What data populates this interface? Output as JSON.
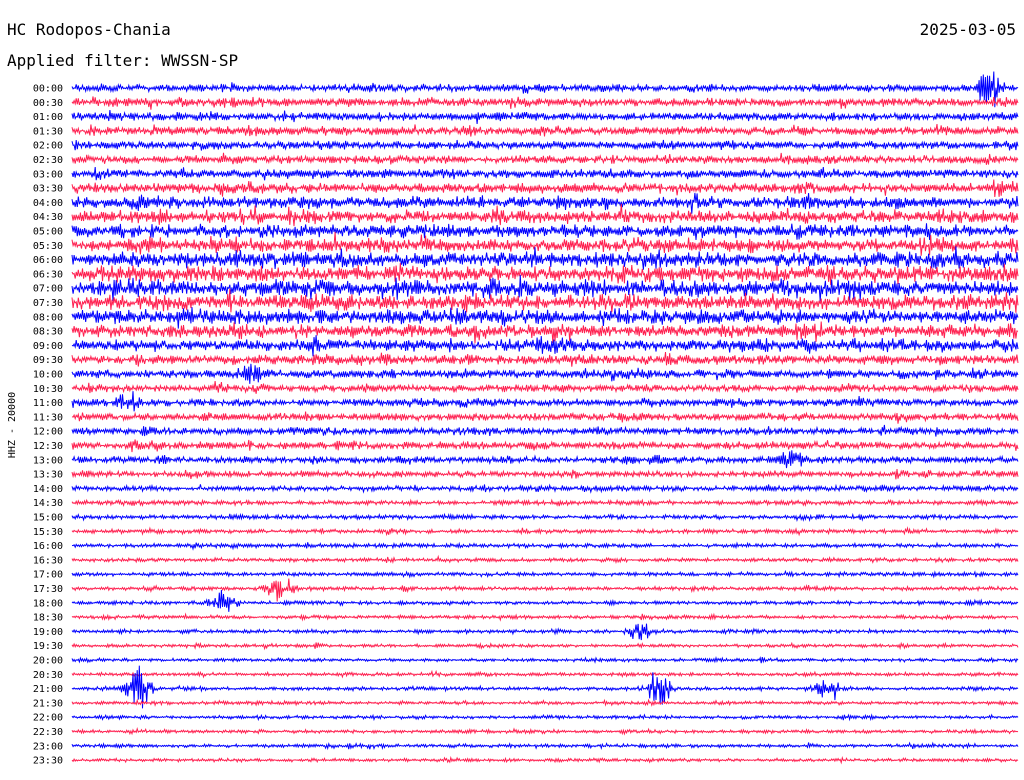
{
  "header": {
    "station": "HC Rodopos-Chania",
    "date": "2025-03-05",
    "filter": "Applied filter: WWSSN-SP"
  },
  "colors": {
    "trace_a": "#0000ff",
    "trace_b": "#ff1f4f",
    "background": "#ffffff",
    "text": "#000000"
  },
  "chart_data": {
    "type": "line",
    "title": "HC Rodopos-Chania",
    "ylabel": "HHZ - 20000",
    "xlabel": "",
    "grid": false,
    "legend": "none",
    "row_labels": [
      "00:00",
      "00:30",
      "01:00",
      "01:30",
      "02:00",
      "02:30",
      "03:00",
      "03:30",
      "04:00",
      "04:30",
      "05:00",
      "05:30",
      "06:00",
      "06:30",
      "07:00",
      "07:30",
      "08:00",
      "08:30",
      "09:00",
      "09:30",
      "10:00",
      "10:30",
      "11:00",
      "11:30",
      "12:00",
      "12:30",
      "13:00",
      "13:30",
      "14:00",
      "14:30",
      "15:00",
      "15:30",
      "16:00",
      "16:30",
      "17:00",
      "17:30",
      "18:00",
      "18:30",
      "19:00",
      "19:30",
      "20:00",
      "20:30",
      "21:00",
      "21:30",
      "22:00",
      "22:30",
      "23:00",
      "23:30"
    ],
    "row_color_cycle": [
      "blue",
      "red"
    ],
    "row_amplitude": [
      0.55,
      0.6,
      0.6,
      0.65,
      0.6,
      0.6,
      0.65,
      0.75,
      0.9,
      1.0,
      1.0,
      1.05,
      1.15,
      1.2,
      1.2,
      1.15,
      1.1,
      1.0,
      0.9,
      0.75,
      0.6,
      0.55,
      0.55,
      0.55,
      0.55,
      0.55,
      0.5,
      0.45,
      0.4,
      0.35,
      0.32,
      0.3,
      0.3,
      0.28,
      0.28,
      0.28,
      0.28,
      0.26,
      0.26,
      0.25,
      0.25,
      0.25,
      0.25,
      0.25,
      0.25,
      0.25,
      0.25,
      0.25
    ],
    "events": [
      {
        "row": "00:00",
        "position": 0.97,
        "strength": 2.6
      },
      {
        "row": "17:30",
        "position": 0.22,
        "strength": 2.2
      },
      {
        "row": "18:00",
        "position": 0.16,
        "strength": 2.0
      },
      {
        "row": "21:00",
        "position": 0.07,
        "strength": 3.2
      },
      {
        "row": "21:00",
        "position": 0.62,
        "strength": 3.0
      },
      {
        "row": "21:00",
        "position": 0.8,
        "strength": 1.8
      },
      {
        "row": "13:00",
        "position": 0.76,
        "strength": 1.6
      },
      {
        "row": "11:00",
        "position": 0.06,
        "strength": 1.5
      },
      {
        "row": "10:00",
        "position": 0.19,
        "strength": 1.4
      },
      {
        "row": "19:00",
        "position": 0.6,
        "strength": 1.3
      }
    ]
  }
}
